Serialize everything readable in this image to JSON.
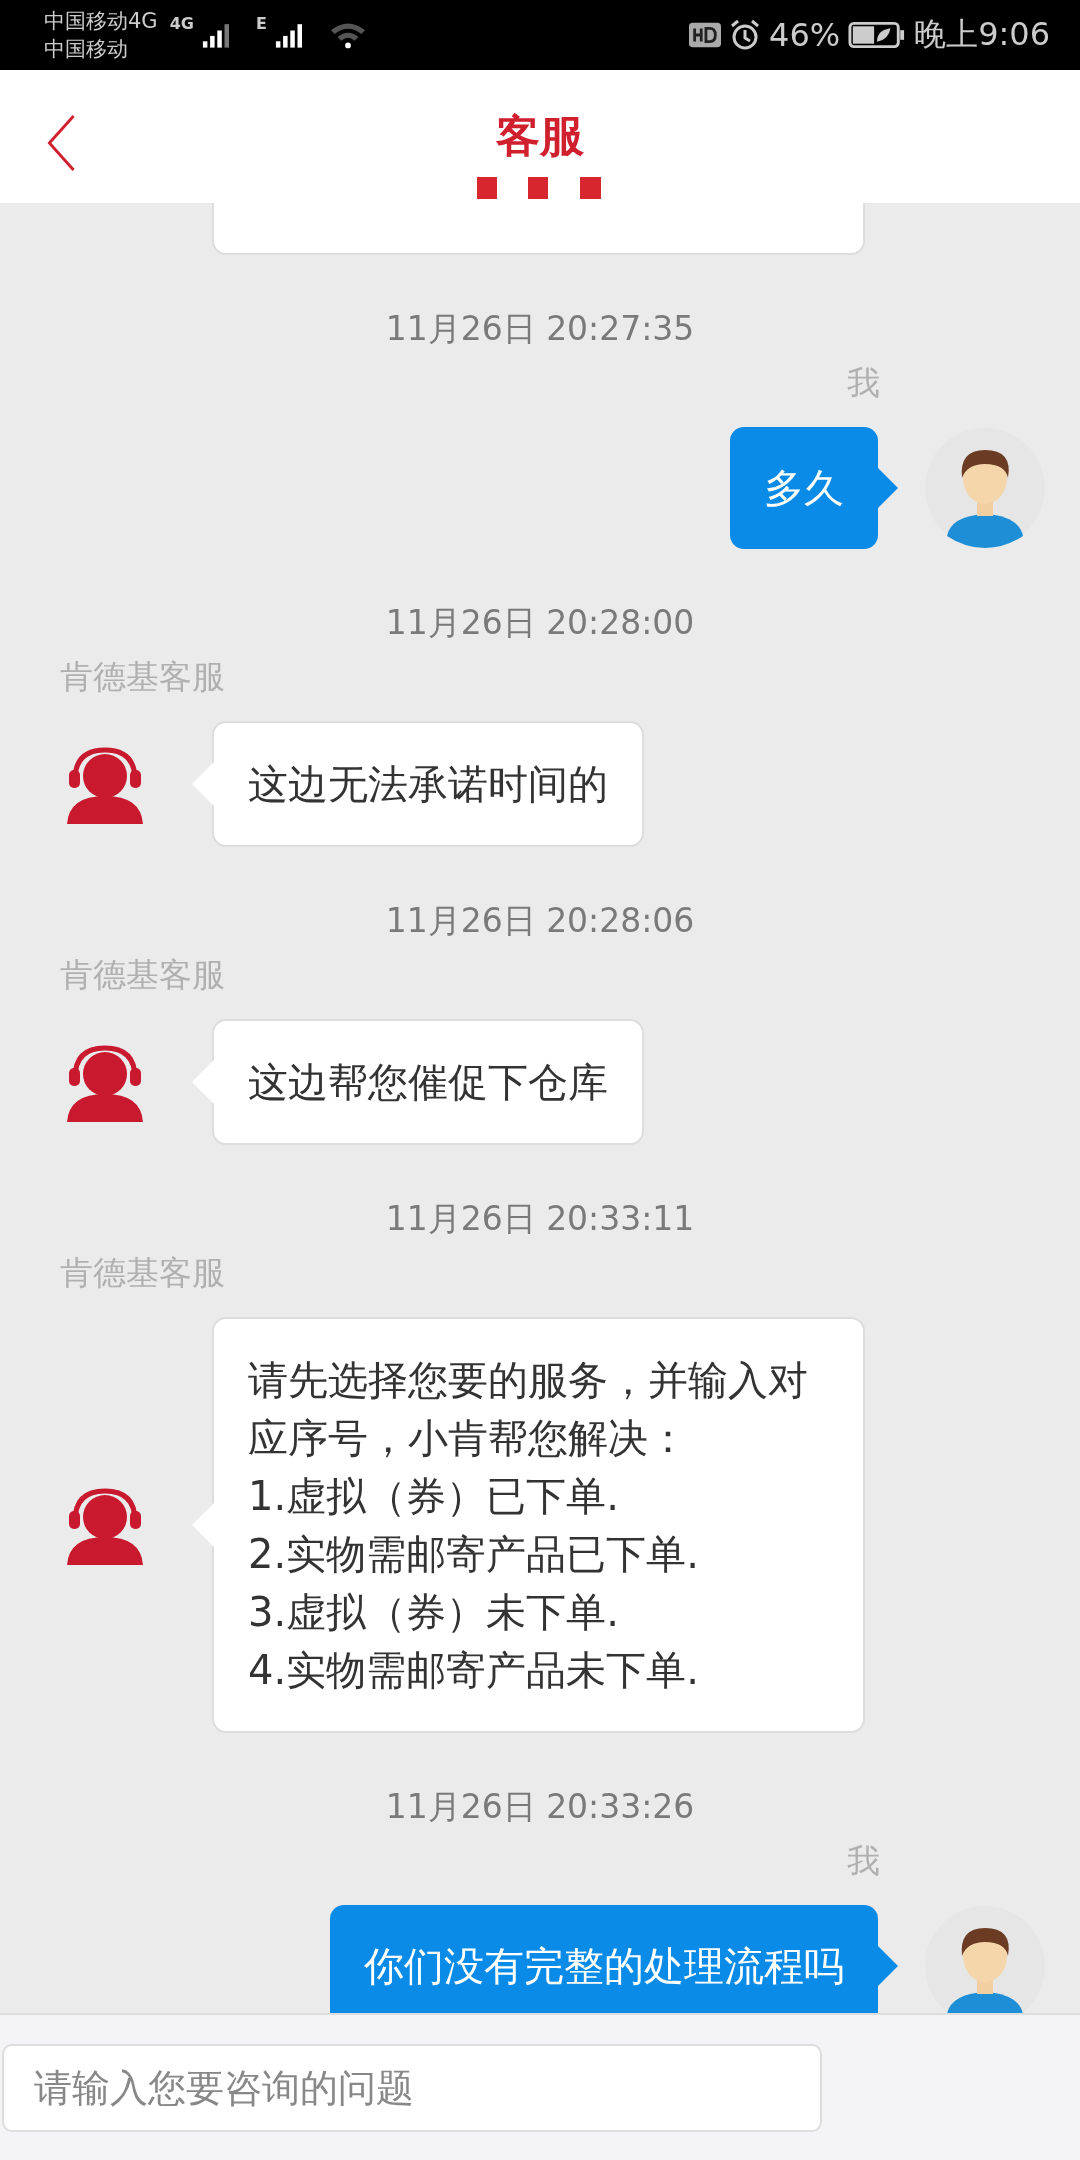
{
  "status_bar": {
    "carriers": [
      "中国移动4G",
      "中国移动"
    ],
    "network_1": "4G",
    "network_2": "E",
    "battery": "46%",
    "time": "晚上9:06"
  },
  "header": {
    "title": "客服"
  },
  "messages": [
    {
      "kind": "partial"
    },
    {
      "kind": "timestamp",
      "text": "11月26日 20:27:35"
    },
    {
      "kind": "sent",
      "sender": "我",
      "text": "多久"
    },
    {
      "kind": "timestamp",
      "text": "11月26日 20:28:00"
    },
    {
      "kind": "received",
      "sender": "肯德基客服",
      "text": "这边无法承诺时间的"
    },
    {
      "kind": "timestamp",
      "text": "11月26日 20:28:06"
    },
    {
      "kind": "received",
      "sender": "肯德基客服",
      "text": "这边帮您催促下仓库"
    },
    {
      "kind": "timestamp",
      "text": "11月26日 20:33:11"
    },
    {
      "kind": "received",
      "sender": "肯德基客服",
      "text": "请先选择您要的服务，并输入对应序号，小肯帮您解决：\n1.虚拟（券）已下单.\n2.实物需邮寄产品已下单.\n3.虚拟（券）未下单.\n4.实物需邮寄产品未下单."
    },
    {
      "kind": "timestamp",
      "text": "11月26日 20:33:26"
    },
    {
      "kind": "sent",
      "sender": "我",
      "text": "你们没有完整的处理流程吗"
    }
  ],
  "input": {
    "placeholder": "请输入您要咨询的问题"
  }
}
